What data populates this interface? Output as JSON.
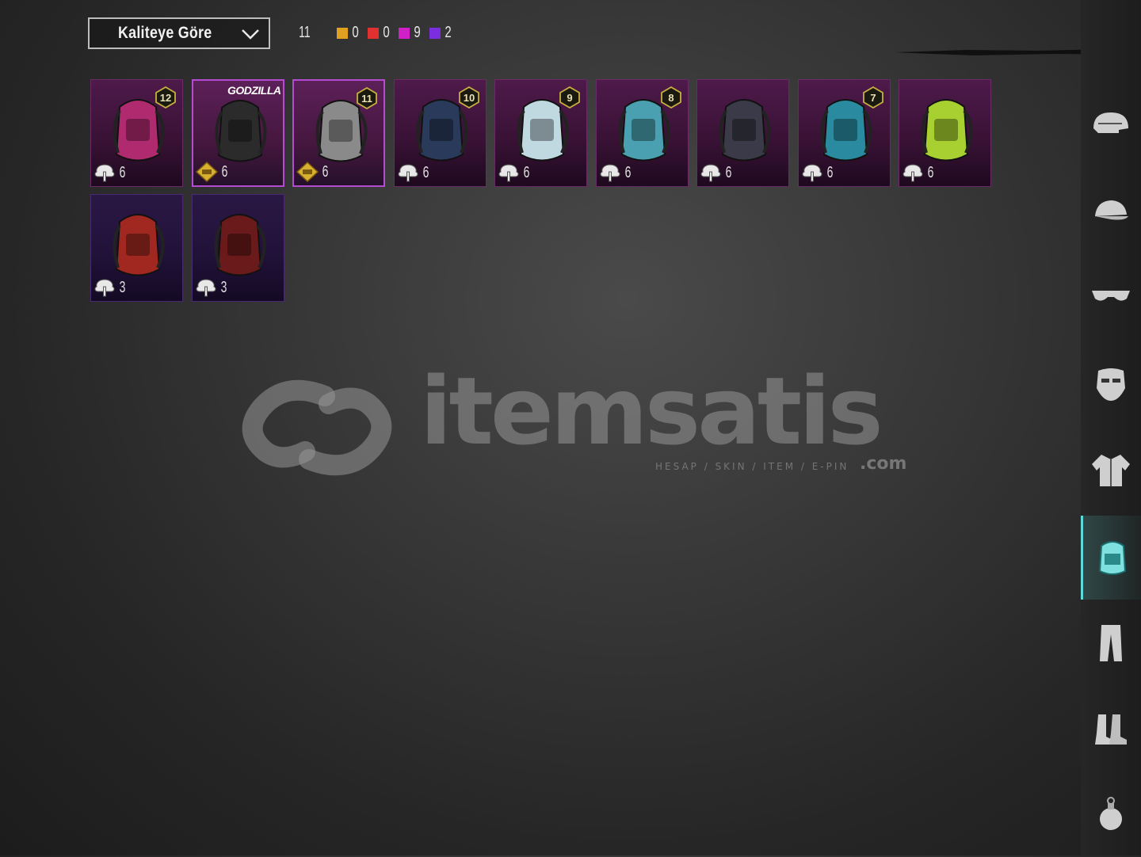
{
  "filter": {
    "sort_label": "Kaliteye Göre"
  },
  "counts": {
    "total": "11",
    "items": [
      {
        "color": "#e0a020",
        "value": "0"
      },
      {
        "color": "#e03030",
        "value": "0"
      },
      {
        "color": "#d020c8",
        "value": "9"
      },
      {
        "color": "#7a2ee0",
        "value": "2"
      }
    ]
  },
  "items": [
    {
      "level": "12",
      "count": "6",
      "currency": "bp-coin",
      "variant": "purple",
      "art": "backpack-spiked-pink-icon"
    },
    {
      "level": "",
      "count": "6",
      "currency": "gold-coin",
      "variant": "purple",
      "brand": "GODZILLA",
      "selected": true,
      "art": "backpack-godzilla-icon"
    },
    {
      "level": "11",
      "count": "6",
      "currency": "gold-coin",
      "variant": "purple",
      "selected": true,
      "art": "backpack-sword-icon"
    },
    {
      "level": "10",
      "count": "6",
      "currency": "bp-coin",
      "variant": "purple",
      "art": "backpack-dark-armor-icon"
    },
    {
      "level": "9",
      "count": "6",
      "currency": "bp-coin",
      "variant": "purple",
      "art": "backpack-tribal-mask-icon"
    },
    {
      "level": "8",
      "count": "6",
      "currency": "bp-coin",
      "variant": "purple",
      "art": "backpack-octopus-icon"
    },
    {
      "level": "",
      "count": "6",
      "currency": "bp-coin",
      "variant": "purple",
      "art": "backpack-shovel-icon"
    },
    {
      "level": "7",
      "count": "6",
      "currency": "bp-coin",
      "variant": "purple",
      "art": "backpack-teal-helmet-icon"
    },
    {
      "level": "",
      "count": "6",
      "currency": "bp-coin",
      "variant": "purple",
      "art": "backpack-green-spiked-icon"
    },
    {
      "level": "",
      "count": "3",
      "currency": "bp-coin",
      "variant": "blue",
      "art": "backpack-red-brick-icon"
    },
    {
      "level": "",
      "count": "3",
      "currency": "bp-coin",
      "variant": "blue",
      "art": "backpack-black-red-icon"
    }
  ],
  "watermark": {
    "brand": "itemsatis",
    "tagline": "HESAP / SKIN / ITEM / E-PIN",
    "suffix": ".com"
  },
  "sidebar": [
    {
      "icon": "helmet-icon",
      "active": false
    },
    {
      "icon": "cap-icon",
      "active": false
    },
    {
      "icon": "glasses-icon",
      "active": false
    },
    {
      "icon": "mask-icon",
      "active": false
    },
    {
      "icon": "jacket-icon",
      "active": false
    },
    {
      "icon": "backpack-icon",
      "active": true
    },
    {
      "icon": "pants-icon",
      "active": false
    },
    {
      "icon": "boots-icon",
      "active": false
    },
    {
      "icon": "grenade-icon",
      "active": false
    }
  ]
}
